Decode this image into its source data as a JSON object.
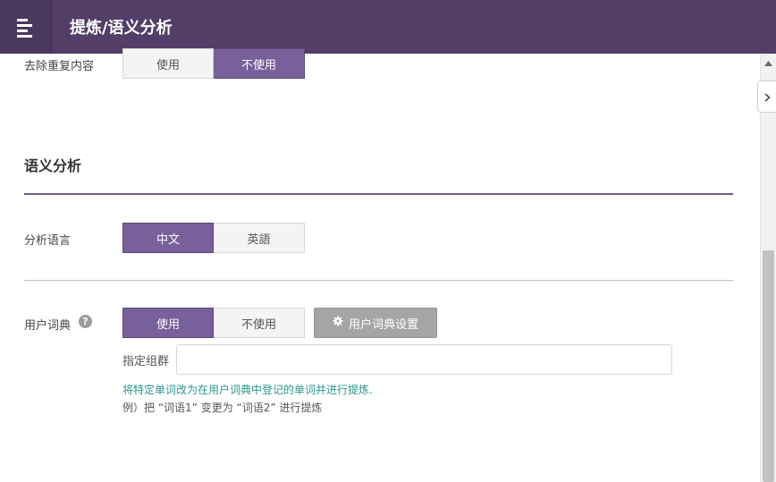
{
  "header": {
    "menu_icon": "menu-icon",
    "title": "提炼/语义分析"
  },
  "remove_duplicates": {
    "label": "去除重复内容",
    "options": [
      "使用",
      "不使用"
    ],
    "selected": "不使用"
  },
  "semantic_section": {
    "title": "语义分析"
  },
  "analysis_language": {
    "label": "分析语言",
    "options": [
      "中文",
      "英語"
    ],
    "selected": "中文"
  },
  "user_dictionary": {
    "label": "用户词典",
    "help_icon": "help-icon",
    "help_glyph": "?",
    "options": [
      "使用",
      "不使用"
    ],
    "selected": "使用",
    "settings_button": "用户词典设置",
    "settings_icon": "gear-icon",
    "group_label": "指定组群",
    "group_value": "",
    "hint": "将特定单词改为在用户词典中登记的单词并进行提炼.",
    "example": "例）把 “词语1” 变更为 “词语2” 进行提炼"
  },
  "colors": {
    "header_bg": "#523e67",
    "active_option": "#78609a",
    "hint_text": "#2b9690"
  }
}
